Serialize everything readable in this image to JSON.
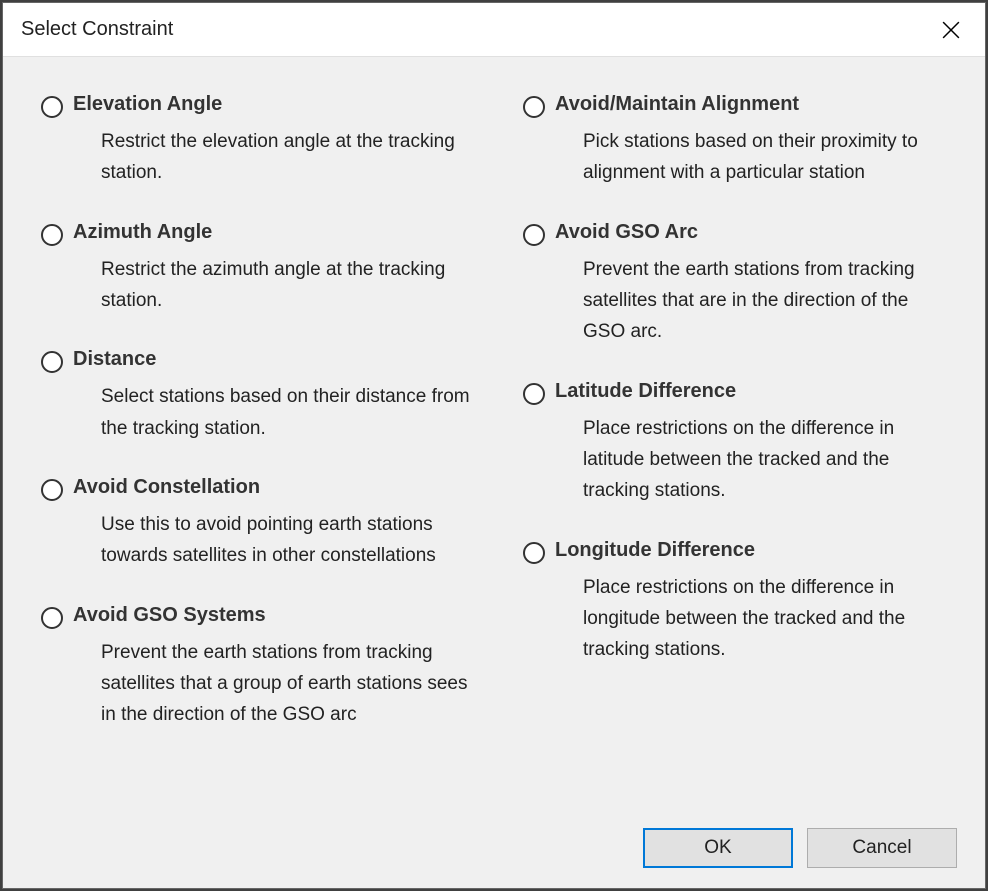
{
  "dialog": {
    "title": "Select Constraint"
  },
  "left": [
    {
      "title": "Elevation Angle",
      "desc": "Restrict the elevation angle at the tracking station."
    },
    {
      "title": "Azimuth Angle",
      "desc": "Restrict the azimuth angle at the tracking station."
    },
    {
      "title": "Distance",
      "desc": "Select stations based on their distance from the tracking station."
    },
    {
      "title": "Avoid Constellation",
      "desc": "Use this to avoid pointing earth stations towards satellites in other constellations"
    },
    {
      "title": "Avoid GSO Systems",
      "desc": "Prevent the earth stations from tracking satellites that a group of earth stations sees in the direction of the GSO arc"
    }
  ],
  "right": [
    {
      "title": "Avoid/Maintain Alignment",
      "desc": "Pick stations based on their proximity to alignment with a particular station"
    },
    {
      "title": "Avoid GSO Arc",
      "desc": "Prevent the earth stations from tracking satellites that are in the direction of the GSO arc."
    },
    {
      "title": "Latitude Difference",
      "desc": "Place restrictions on the difference in latitude between the tracked and the tracking stations."
    },
    {
      "title": "Longitude Difference",
      "desc": "Place restrictions on the difference in longitude between the tracked and the tracking stations."
    }
  ],
  "buttons": {
    "ok": "OK",
    "cancel": "Cancel"
  }
}
